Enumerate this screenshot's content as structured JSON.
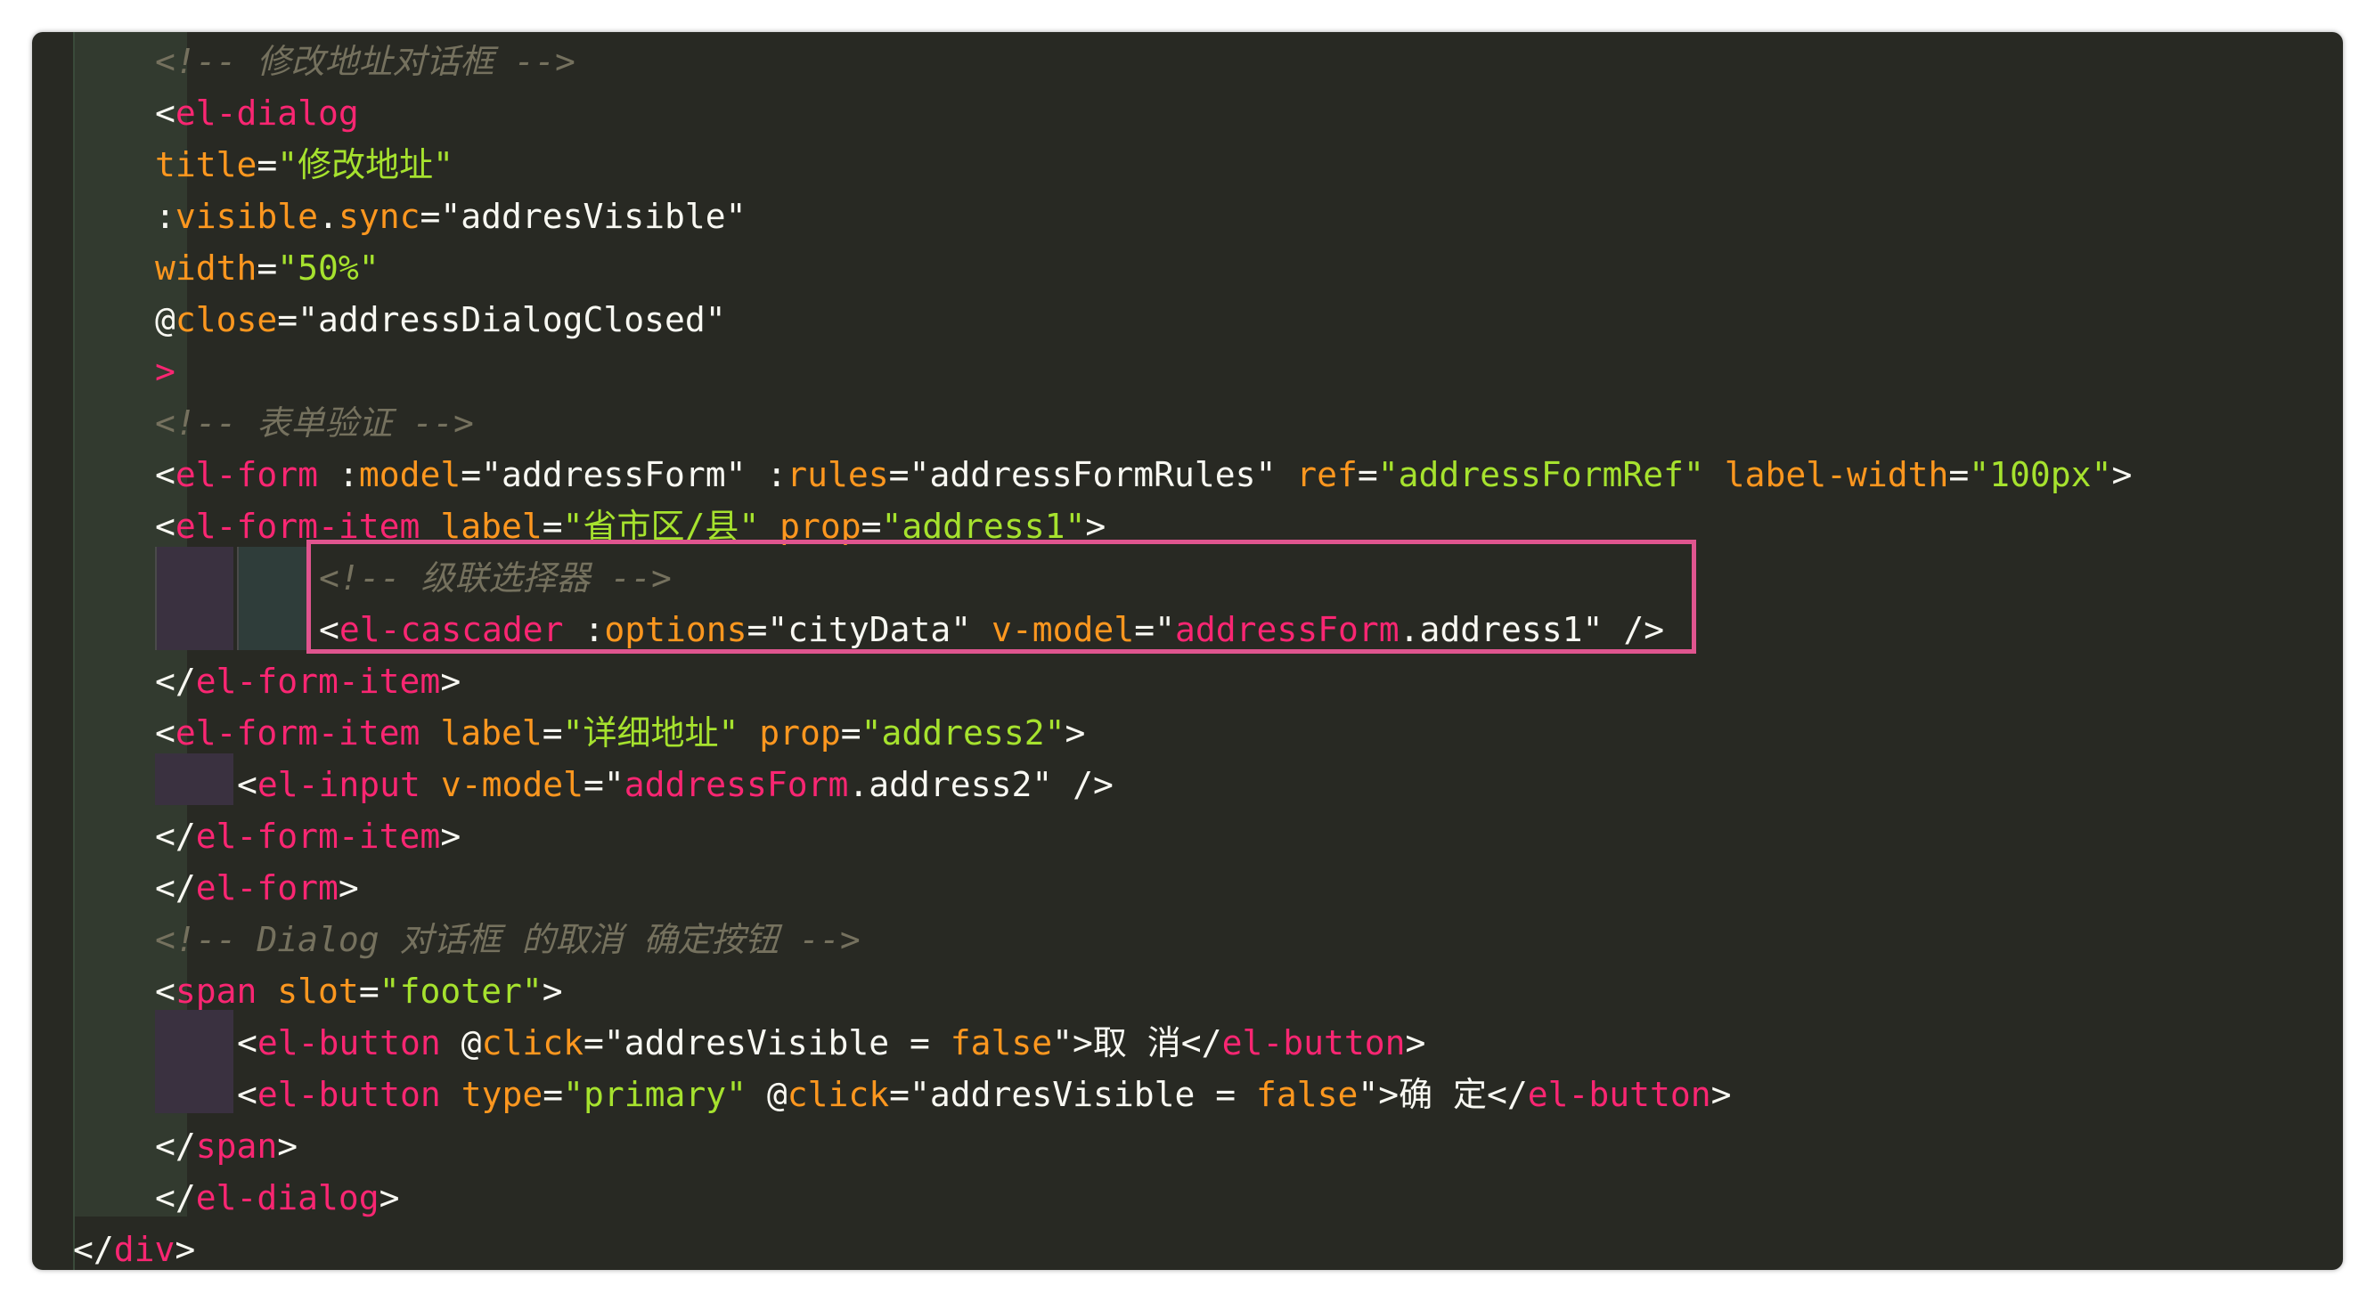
{
  "editor": {
    "lines": [
      [
        {
          "t": "<!-- 修改地址对话框 -->",
          "c": "comment"
        }
      ],
      [
        {
          "t": "<",
          "c": "plain"
        },
        {
          "t": "el-dialog",
          "c": "tag"
        }
      ],
      [
        {
          "t": "title",
          "c": "attr"
        },
        {
          "t": "=",
          "c": "plain"
        },
        {
          "t": "\"修改地址\"",
          "c": "strg"
        }
      ],
      [
        {
          "t": ":",
          "c": "plain"
        },
        {
          "t": "visible",
          "c": "attr"
        },
        {
          "t": ".",
          "c": "plain"
        },
        {
          "t": "sync",
          "c": "attr"
        },
        {
          "t": "=",
          "c": "plain"
        },
        {
          "t": "\"addresVisible\"",
          "c": "plain"
        }
      ],
      [
        {
          "t": "width",
          "c": "attr"
        },
        {
          "t": "=",
          "c": "plain"
        },
        {
          "t": "\"50%\"",
          "c": "strg"
        }
      ],
      [
        {
          "t": "@",
          "c": "plain"
        },
        {
          "t": "close",
          "c": "attr"
        },
        {
          "t": "=",
          "c": "plain"
        },
        {
          "t": "\"addressDialogClosed\"",
          "c": "plain"
        }
      ],
      [
        {
          "t": ">",
          "c": "tag"
        }
      ],
      [
        {
          "t": "<!-- 表单验证 -->",
          "c": "comment"
        }
      ],
      [
        {
          "t": "<",
          "c": "plain"
        },
        {
          "t": "el-form",
          "c": "tag"
        },
        {
          "t": " :",
          "c": "plain"
        },
        {
          "t": "model",
          "c": "attr"
        },
        {
          "t": "=",
          "c": "plain"
        },
        {
          "t": "\"addressForm\"",
          "c": "plain"
        },
        {
          "t": " :",
          "c": "plain"
        },
        {
          "t": "rules",
          "c": "attr"
        },
        {
          "t": "=",
          "c": "plain"
        },
        {
          "t": "\"addressFormRules\"",
          "c": "plain"
        },
        {
          "t": " ",
          "c": "plain"
        },
        {
          "t": "ref",
          "c": "attr"
        },
        {
          "t": "=",
          "c": "plain"
        },
        {
          "t": "\"addressFormRef\"",
          "c": "strg"
        },
        {
          "t": " ",
          "c": "plain"
        },
        {
          "t": "label-width",
          "c": "attr"
        },
        {
          "t": "=",
          "c": "plain"
        },
        {
          "t": "\"100px\"",
          "c": "strg"
        },
        {
          "t": ">",
          "c": "plain"
        }
      ],
      [
        {
          "t": "<",
          "c": "plain"
        },
        {
          "t": "el-form-item",
          "c": "tag"
        },
        {
          "t": " ",
          "c": "plain"
        },
        {
          "t": "label",
          "c": "attr"
        },
        {
          "t": "=",
          "c": "plain"
        },
        {
          "t": "\"省市区/县\"",
          "c": "strg"
        },
        {
          "t": " ",
          "c": "plain"
        },
        {
          "t": "prop",
          "c": "attr"
        },
        {
          "t": "=",
          "c": "plain"
        },
        {
          "t": "\"address1\"",
          "c": "strg"
        },
        {
          "t": ">",
          "c": "plain"
        }
      ],
      [
        {
          "t": "<!-- 级联选择器 -->",
          "c": "comment"
        }
      ],
      [
        {
          "t": "<",
          "c": "plain"
        },
        {
          "t": "el-cascader",
          "c": "tag"
        },
        {
          "t": " :",
          "c": "plain"
        },
        {
          "t": "options",
          "c": "attr"
        },
        {
          "t": "=",
          "c": "plain"
        },
        {
          "t": "\"cityData\"",
          "c": "plain"
        },
        {
          "t": " ",
          "c": "plain"
        },
        {
          "t": "v-model",
          "c": "attr"
        },
        {
          "t": "=",
          "c": "plain"
        },
        {
          "t": "\"",
          "c": "plain"
        },
        {
          "t": "addressForm",
          "c": "tag"
        },
        {
          "t": ".address1\" />",
          "c": "plain"
        }
      ],
      [
        {
          "t": "</",
          "c": "plain"
        },
        {
          "t": "el-form-item",
          "c": "tag"
        },
        {
          "t": ">",
          "c": "plain"
        }
      ],
      [
        {
          "t": "<",
          "c": "plain"
        },
        {
          "t": "el-form-item",
          "c": "tag"
        },
        {
          "t": " ",
          "c": "plain"
        },
        {
          "t": "label",
          "c": "attr"
        },
        {
          "t": "=",
          "c": "plain"
        },
        {
          "t": "\"详细地址\"",
          "c": "strg"
        },
        {
          "t": " ",
          "c": "plain"
        },
        {
          "t": "prop",
          "c": "attr"
        },
        {
          "t": "=",
          "c": "plain"
        },
        {
          "t": "\"address2\"",
          "c": "strg"
        },
        {
          "t": ">",
          "c": "plain"
        }
      ],
      [
        {
          "t": "<",
          "c": "plain"
        },
        {
          "t": "el-input",
          "c": "tag"
        },
        {
          "t": " ",
          "c": "plain"
        },
        {
          "t": "v-model",
          "c": "attr"
        },
        {
          "t": "=",
          "c": "plain"
        },
        {
          "t": "\"",
          "c": "plain"
        },
        {
          "t": "addressForm",
          "c": "tag"
        },
        {
          "t": ".address2\" />",
          "c": "plain"
        }
      ],
      [
        {
          "t": "</",
          "c": "plain"
        },
        {
          "t": "el-form-item",
          "c": "tag"
        },
        {
          "t": ">",
          "c": "plain"
        }
      ],
      [
        {
          "t": "</",
          "c": "plain"
        },
        {
          "t": "el-form",
          "c": "tag"
        },
        {
          "t": ">",
          "c": "plain"
        }
      ],
      [
        {
          "t": "<!-- Dialog 对话框 的取消 确定按钮 -->",
          "c": "comment"
        }
      ],
      [
        {
          "t": "<",
          "c": "plain"
        },
        {
          "t": "span",
          "c": "tag"
        },
        {
          "t": " ",
          "c": "plain"
        },
        {
          "t": "slot",
          "c": "attr"
        },
        {
          "t": "=",
          "c": "plain"
        },
        {
          "t": "\"footer\"",
          "c": "strg"
        },
        {
          "t": ">",
          "c": "plain"
        }
      ],
      [
        {
          "t": "<",
          "c": "plain"
        },
        {
          "t": "el-button",
          "c": "tag"
        },
        {
          "t": " @",
          "c": "plain"
        },
        {
          "t": "click",
          "c": "attr"
        },
        {
          "t": "=",
          "c": "plain"
        },
        {
          "t": "\"addresVisible = ",
          "c": "plain"
        },
        {
          "t": "false",
          "c": "bool"
        },
        {
          "t": "\">取 消</",
          "c": "plain"
        },
        {
          "t": "el-button",
          "c": "tag"
        },
        {
          "t": ">",
          "c": "plain"
        }
      ],
      [
        {
          "t": "<",
          "c": "plain"
        },
        {
          "t": "el-button",
          "c": "tag"
        },
        {
          "t": " ",
          "c": "plain"
        },
        {
          "t": "type",
          "c": "attr"
        },
        {
          "t": "=",
          "c": "plain"
        },
        {
          "t": "\"primary\"",
          "c": "strg"
        },
        {
          "t": " @",
          "c": "plain"
        },
        {
          "t": "click",
          "c": "attr"
        },
        {
          "t": "=",
          "c": "plain"
        },
        {
          "t": "\"addresVisible = ",
          "c": "plain"
        },
        {
          "t": "false",
          "c": "bool"
        },
        {
          "t": "\">确 定</",
          "c": "plain"
        },
        {
          "t": "el-button",
          "c": "tag"
        },
        {
          "t": ">",
          "c": "plain"
        }
      ],
      [
        {
          "t": "</",
          "c": "plain"
        },
        {
          "t": "span",
          "c": "tag"
        },
        {
          "t": ">",
          "c": "plain"
        }
      ],
      [
        {
          "t": "</",
          "c": "plain"
        },
        {
          "t": "el-dialog",
          "c": "tag"
        },
        {
          "t": ">",
          "c": "plain"
        }
      ],
      [
        {
          "t": "</",
          "c": "plain"
        },
        {
          "t": "div",
          "c": "tag"
        },
        {
          "t": ">",
          "c": "plain"
        }
      ]
    ]
  }
}
